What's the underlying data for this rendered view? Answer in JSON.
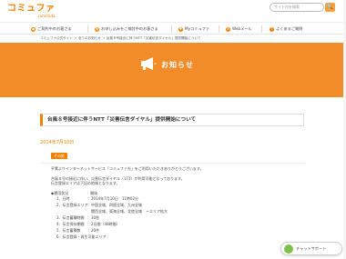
{
  "header": {
    "logo_text": "コミュファ",
    "logo_sub": "commufa",
    "search_placeholder": "サイト内を検索",
    "search_button": "🔍"
  },
  "nav": {
    "items": [
      {
        "label": "ご契約中のお客さま",
        "icon": "user-icon"
      },
      {
        "label": "お申し込みをご検討中のお客さま",
        "icon": "document-icon"
      },
      {
        "label": "Myコミュファ",
        "icon": "heart-icon"
      },
      {
        "label": "Webメール",
        "icon": "mail-icon"
      },
      {
        "label": "よくあるご質問",
        "icon": "question-icon"
      }
    ]
  },
  "breadcrumb": "コミュファ公式サイト ＞ 全てのお知らせ ＞ 台風８号接近に伴うNTT「災害伝言ダイヤル」提供開始について",
  "hero": {
    "title": "お知らせ",
    "color": "#f28c28"
  },
  "article": {
    "headline": "台風８号接近に伴うNTT「災害伝言ダイヤル」提供開始について",
    "date": "2014年7月10日",
    "tag": "その他",
    "paragraphs": [
      "平素よりインターネットサービス「コミュファ光」をご利用いただきありがとうございます。",
      "台風８号の接近に伴い、災害伝言ダイヤル（171）が利用可能となっております。",
      "伝言登録エリアは下記の地域となります。"
    ],
    "section_title": "◆運用状況　　　　　：開始",
    "details": [
      {
        "k": "1．日時",
        "v": "：2014年7月10日　11時02分"
      },
      {
        "k": "2．伝言登録エリア",
        "v": "：中国全域、四国全域、九州全域"
      },
      {
        "k": "",
        "v": "　関西全域、東海全域、北陸全域　ーエリア拡大"
      },
      {
        "k": "3．伝言蓄積時間",
        "v": "：30秒"
      },
      {
        "k": "4．伝言保存期間",
        "v": "：2日間（48時間）"
      },
      {
        "k": "5．伝言蓄積数",
        "v": "：20件"
      },
      {
        "k": "6．伝言登録・再生可能エリア",
        "v": ""
      }
    ]
  },
  "support_widget": {
    "label": "チャットサポート"
  }
}
